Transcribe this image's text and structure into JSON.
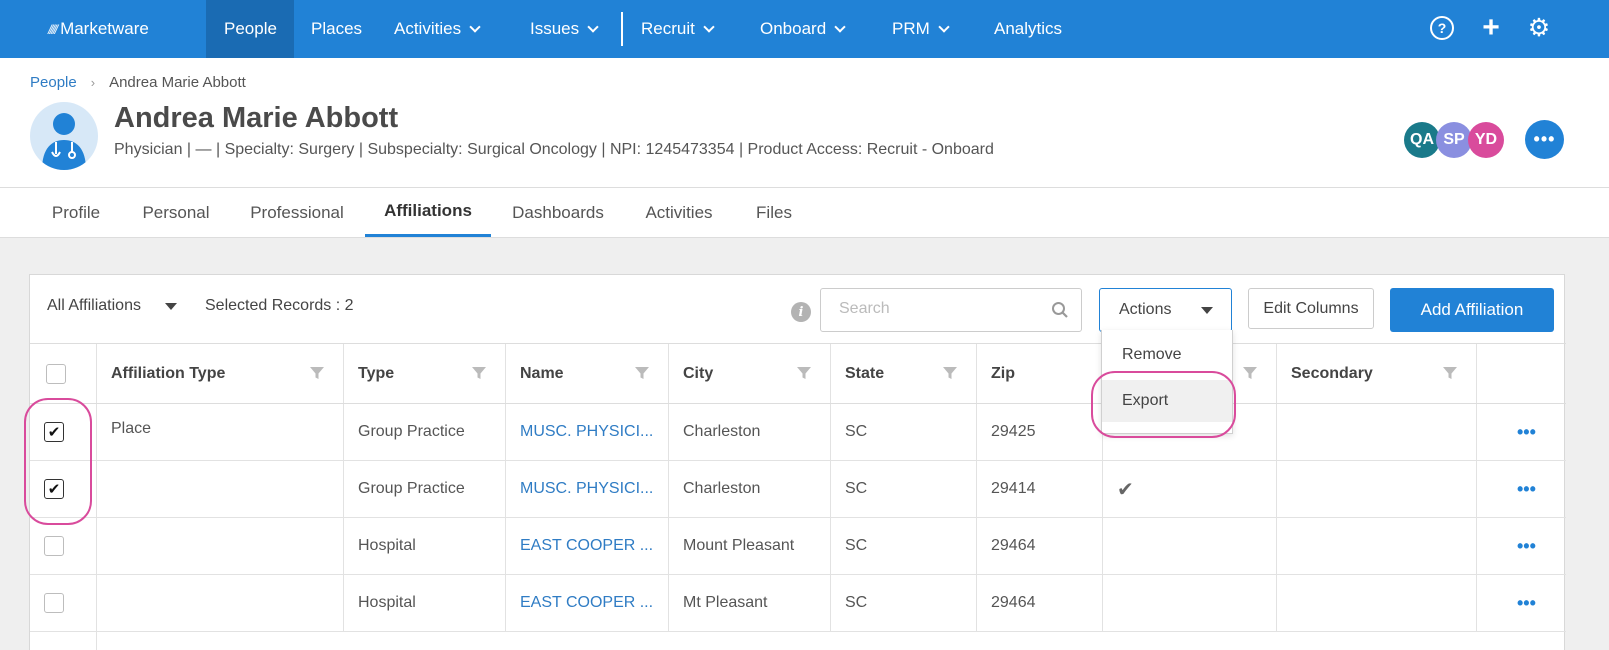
{
  "nav": {
    "logo": "Marketware",
    "items": [
      {
        "label": "People",
        "active": true
      },
      {
        "label": "Places"
      },
      {
        "label": "Activities",
        "dropdown": true
      },
      {
        "label": "Issues",
        "dropdown": true
      },
      {
        "label": "Recruit",
        "dropdown": true
      },
      {
        "label": "Onboard",
        "dropdown": true
      },
      {
        "label": "PRM",
        "dropdown": true
      },
      {
        "label": "Analytics"
      }
    ],
    "icons": [
      "help-icon",
      "plus-icon",
      "gear-icon"
    ]
  },
  "breadcrumb": {
    "parent": "People",
    "current": "Andrea Marie Abbott"
  },
  "person": {
    "name": "Andrea Marie Abbott",
    "subtitle": "Physician | — | Specialty: Surgery | Subspecialty: Surgical Oncology | NPI: 1245473354 | Product Access: Recruit - Onboard"
  },
  "users": [
    {
      "initials": "QA",
      "color": "#1a7a8a"
    },
    {
      "initials": "SP",
      "color": "#8a8fe0"
    },
    {
      "initials": "YD",
      "color": "#d94b9c"
    }
  ],
  "tabs": [
    {
      "label": "Profile"
    },
    {
      "label": "Personal"
    },
    {
      "label": "Professional"
    },
    {
      "label": "Affiliations",
      "active": true
    },
    {
      "label": "Dashboards"
    },
    {
      "label": "Activities"
    },
    {
      "label": "Files"
    }
  ],
  "toolbar": {
    "filter_label": "All Affiliations",
    "selected_label": "Selected Records : 2",
    "search_placeholder": "Search",
    "actions_label": "Actions",
    "edit_columns_label": "Edit Columns",
    "add_label": "Add Affiliation"
  },
  "actions_menu": [
    {
      "label": "Remove"
    },
    {
      "label": "Export",
      "hover": true
    }
  ],
  "table": {
    "columns": [
      "Affiliation Type",
      "Type",
      "Name",
      "City",
      "State",
      "Zip",
      "",
      "Secondary"
    ],
    "group_label": "Place",
    "rows": [
      {
        "checked": true,
        "type": "Group Practice",
        "name": "MUSC. PHYSICI...",
        "city": "Charleston",
        "state": "SC",
        "zip": "29425",
        "primary": false
      },
      {
        "checked": true,
        "type": "Group Practice",
        "name": "MUSC. PHYSICI...",
        "city": "Charleston",
        "state": "SC",
        "zip": "29414",
        "primary": true
      },
      {
        "checked": false,
        "type": "Hospital",
        "name": "EAST COOPER ...",
        "city": "Mount Pleasant",
        "state": "SC",
        "zip": "29464",
        "primary": false
      },
      {
        "checked": false,
        "type": "Hospital",
        "name": "EAST COOPER ...",
        "city": "Mt Pleasant",
        "state": "SC",
        "zip": "29464",
        "primary": false
      }
    ],
    "row_menu": "•••"
  },
  "more_label": "•••"
}
